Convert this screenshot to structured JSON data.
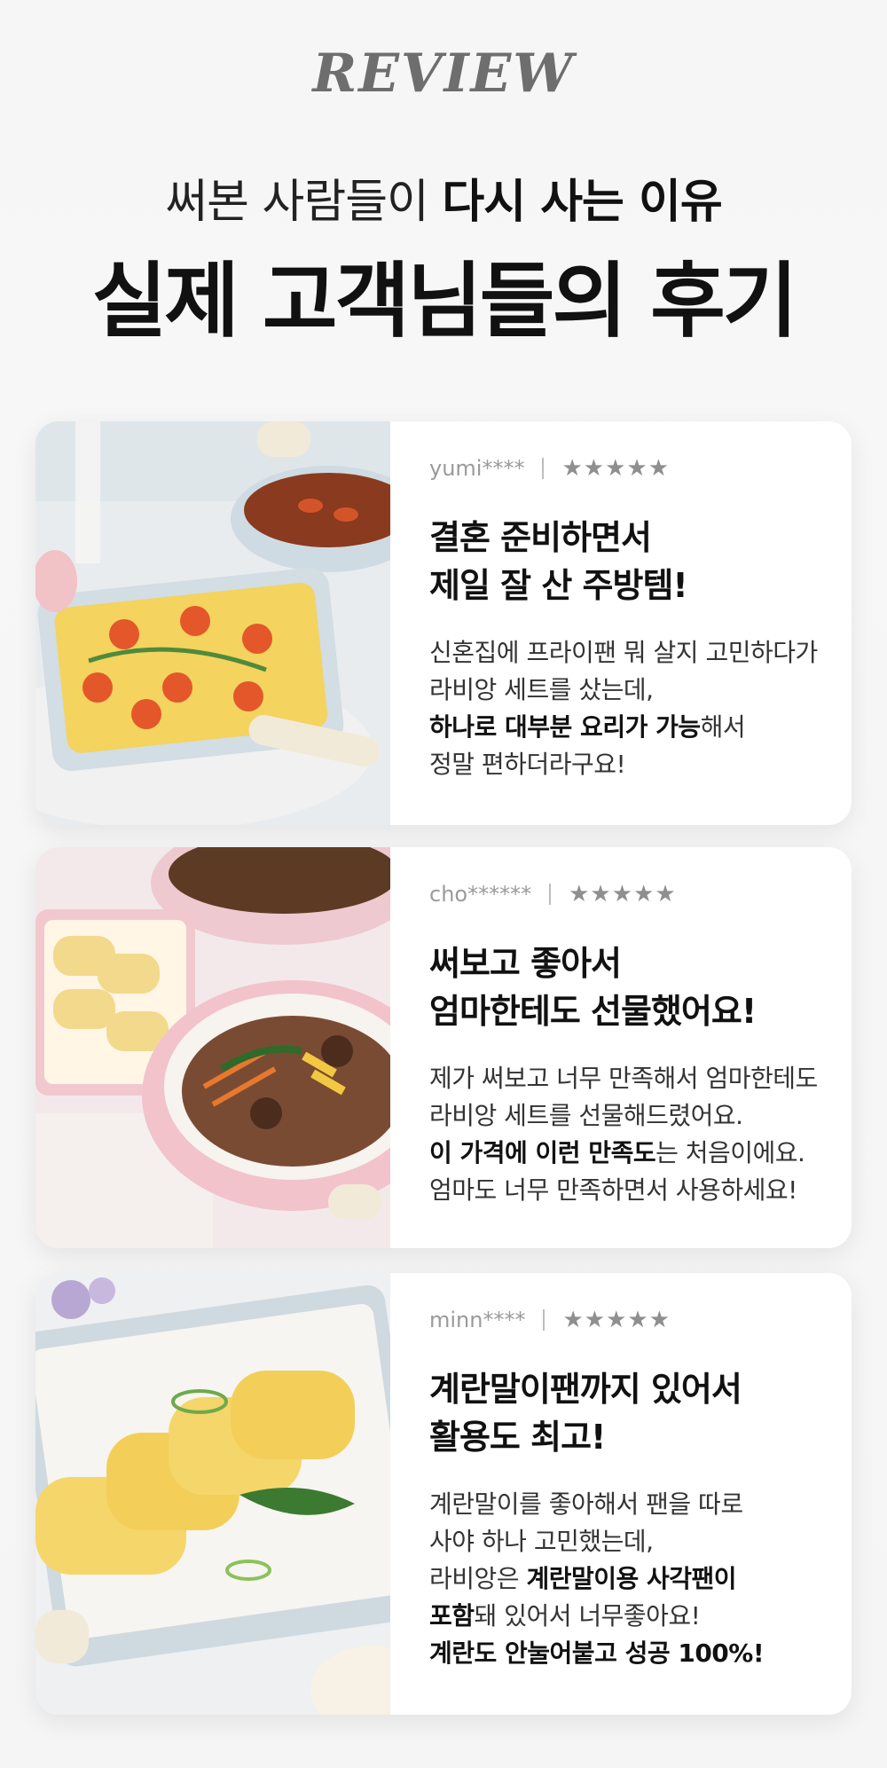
{
  "header": {
    "eyebrow": "REVIEW",
    "subtitle_normal": "써본 사람들이",
    "subtitle_bold": "다시 사는 이유",
    "title": "실제 고객님들의 후기"
  },
  "reviews": [
    {
      "user": "yumi****",
      "stars": "★★★★★",
      "headline_1": "결혼 준비하면서",
      "headline_2": "제일 잘 산 주방템!",
      "line_1": "신혼집에 프라이팬 뭐 살지 고민하다가",
      "line_2": "라비앙 세트를 샀는데,",
      "line_3_bold": "하나로 대부분 요리가 가능",
      "line_3_rest": "해서",
      "line_4": "정말 편하더라구요!"
    },
    {
      "user": "cho******",
      "stars": "★★★★★",
      "headline_1": "써보고 좋아서",
      "headline_2": "엄마한테도 선물했어요!",
      "line_1": "제가 써보고 너무 만족해서 엄마한테도",
      "line_2": "라비앙 세트를 선물해드렸어요.",
      "line_3_bold": "이 가격에 이런 만족도",
      "line_3_rest": "는 처음이에요.",
      "line_4": "엄마도 너무 만족하면서 사용하세요!"
    },
    {
      "user": "minn****",
      "stars": "★★★★★",
      "headline_1": "계란말이팬까지 있어서",
      "headline_2": "활용도 최고!",
      "line_1": "계란말이를 좋아해서 팬을 따로",
      "line_2": "사야 하나 고민했는데,",
      "line_3_pre": "라비앙은 ",
      "line_3_bold": "계란말이용 사각팬이",
      "line_4_bold": "포함",
      "line_4_rest": "돼 있어서 너무좋아요!",
      "line_5_bold": "계란도 안눌어붙고 성공 100%!"
    }
  ]
}
